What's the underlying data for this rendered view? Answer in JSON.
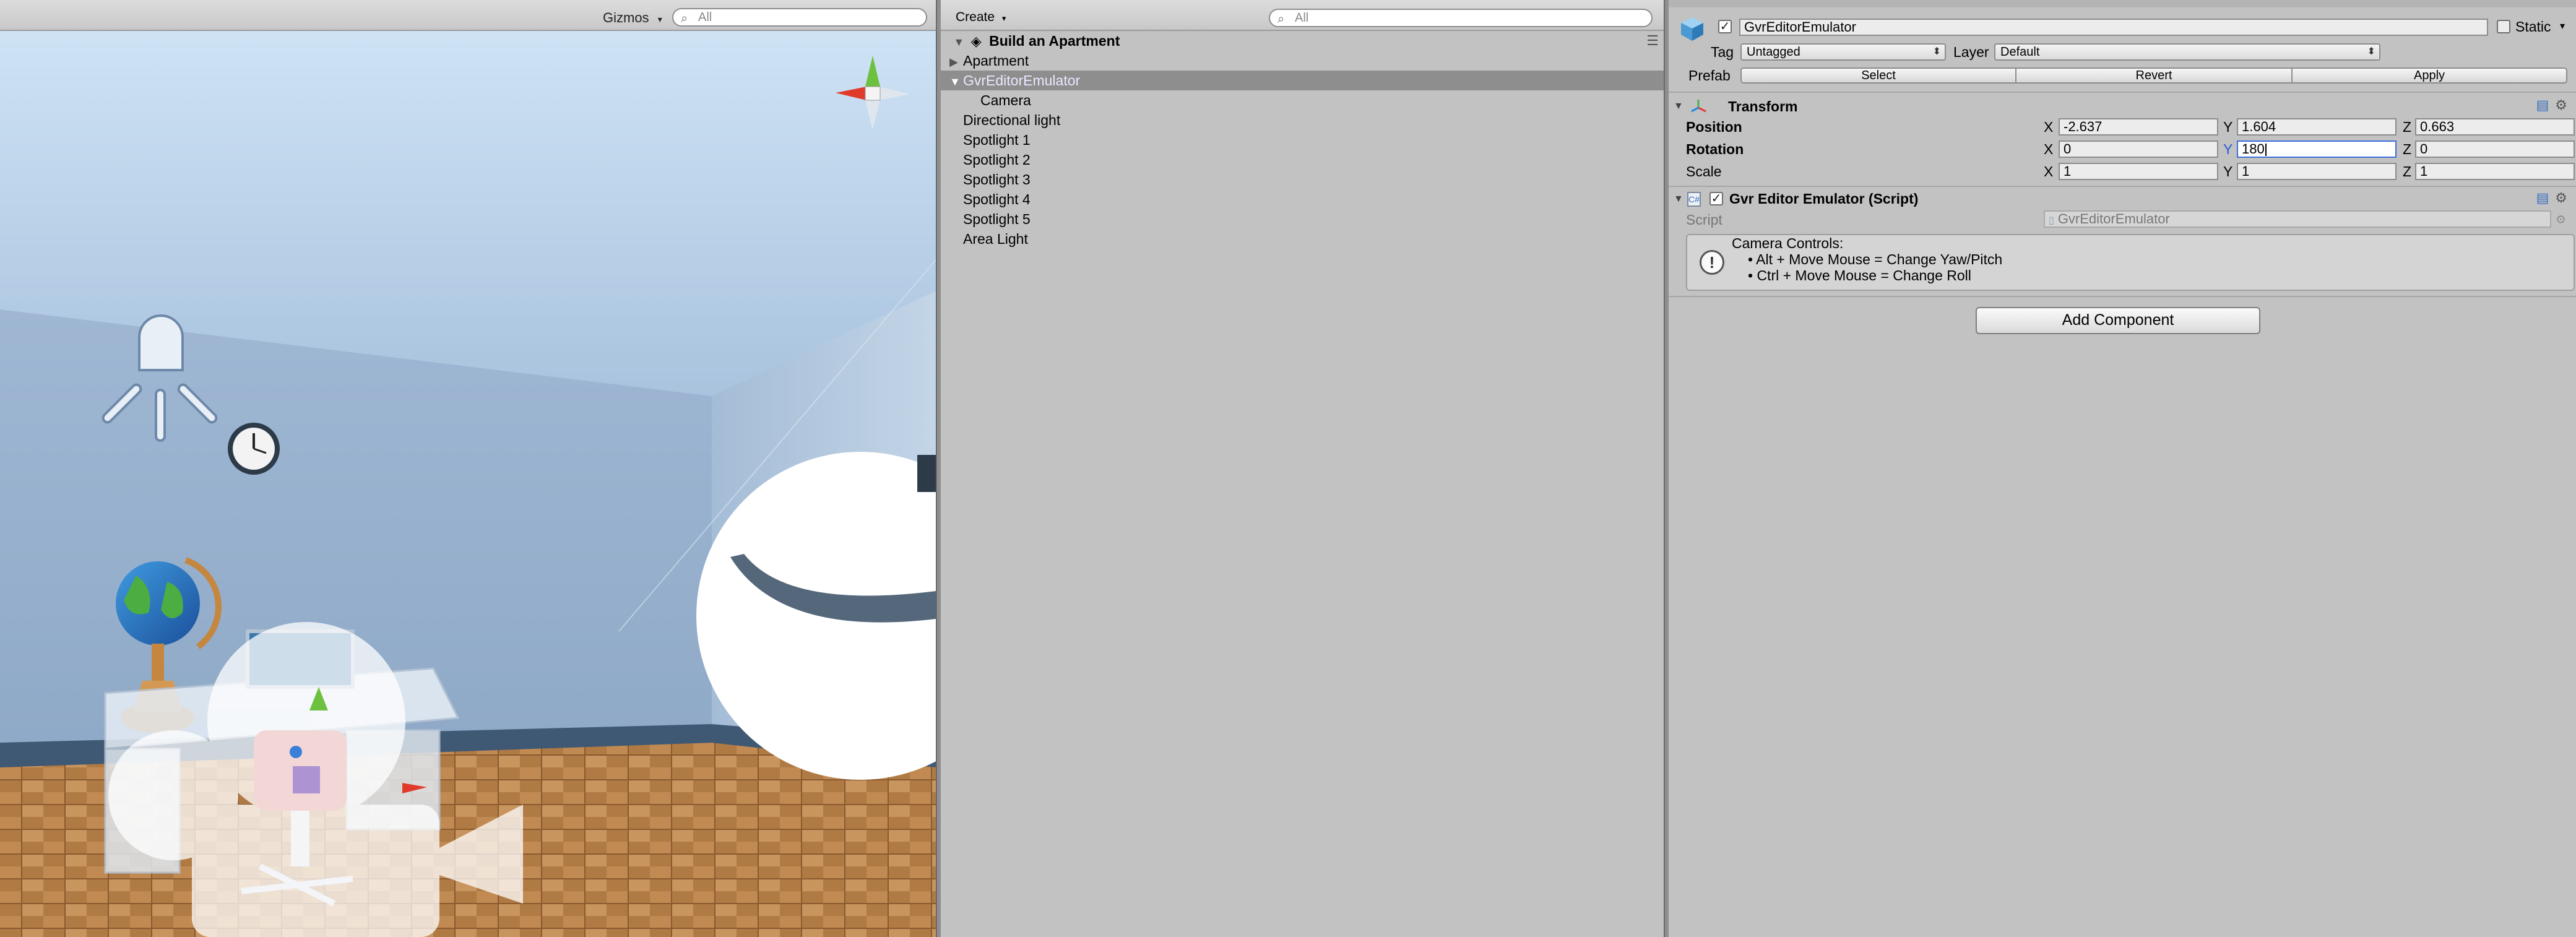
{
  "scene": {
    "gizmos_label": "Gizmos",
    "search_placeholder": "All"
  },
  "hierarchy": {
    "create_label": "Create",
    "search_placeholder": "All",
    "root": "Build an Apartment",
    "items": [
      {
        "label": "Apartment",
        "indent": 1,
        "expander": "collapsed",
        "selected": false
      },
      {
        "label": "GvrEditorEmulator",
        "indent": 1,
        "expander": "expanded",
        "selected": true
      },
      {
        "label": "Camera",
        "indent": 2,
        "expander": "none",
        "selected": false
      },
      {
        "label": "Directional light",
        "indent": 1,
        "expander": "none",
        "selected": false
      },
      {
        "label": "Spotlight 1",
        "indent": 1,
        "expander": "none",
        "selected": false
      },
      {
        "label": "Spotlight 2",
        "indent": 1,
        "expander": "none",
        "selected": false
      },
      {
        "label": "Spotlight 3",
        "indent": 1,
        "expander": "none",
        "selected": false
      },
      {
        "label": "Spotlight 4",
        "indent": 1,
        "expander": "none",
        "selected": false
      },
      {
        "label": "Spotlight 5",
        "indent": 1,
        "expander": "none",
        "selected": false
      },
      {
        "label": "Area Light",
        "indent": 1,
        "expander": "none",
        "selected": false
      }
    ]
  },
  "inspector": {
    "object_name": "GvrEditorEmulator",
    "static_label": "Static",
    "tag_label": "Tag",
    "tag_value": "Untagged",
    "layer_label": "Layer",
    "layer_value": "Default",
    "prefab_label": "Prefab",
    "prefab_select": "Select",
    "prefab_revert": "Revert",
    "prefab_apply": "Apply",
    "transform": {
      "title": "Transform",
      "position_label": "Position",
      "rotation_label": "Rotation",
      "scale_label": "Scale",
      "x": "X",
      "y": "Y",
      "z": "Z",
      "position": {
        "x": "-2.637",
        "y": "1.604",
        "z": "0.663"
      },
      "rotation": {
        "x": "0",
        "y": "180",
        "z": "0"
      },
      "scale": {
        "x": "1",
        "y": "1",
        "z": "1"
      }
    },
    "script_component": {
      "title": "Gvr Editor Emulator (Script)",
      "script_label": "Script",
      "script_value": "GvrEditorEmulator",
      "help_title": "Camera Controls:",
      "help_line1": "• Alt + Move Mouse = Change Yaw/Pitch",
      "help_line2": "• Ctrl + Move Mouse = Change Roll"
    },
    "add_component_label": "Add Component"
  }
}
